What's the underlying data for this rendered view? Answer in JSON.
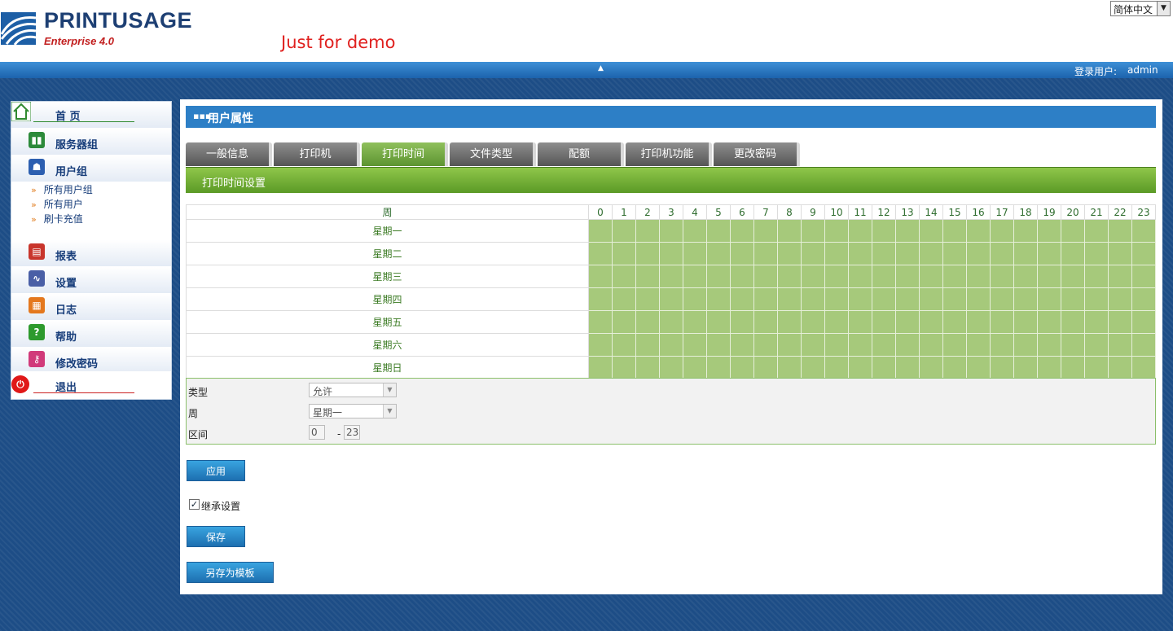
{
  "header": {
    "brand_name": "PRINTUSAGE",
    "brand_edition": "Enterprise 4.0",
    "demo_text": "Just for demo",
    "language": "简体中文"
  },
  "topbar": {
    "login_label": "登录用户:",
    "login_user": "admin"
  },
  "sidebar": {
    "items": [
      {
        "label": "首 页",
        "icon": "home-icon"
      },
      {
        "label": "服务器组",
        "icon": "server-group-icon"
      },
      {
        "label": "用户组",
        "icon": "user-group-icon"
      },
      {
        "label": "报表",
        "icon": "report-icon"
      },
      {
        "label": "设置",
        "icon": "settings-icon"
      },
      {
        "label": "日志",
        "icon": "log-icon"
      },
      {
        "label": "帮助",
        "icon": "help-icon"
      },
      {
        "label": "修改密码",
        "icon": "key-icon"
      },
      {
        "label": "退出",
        "icon": "exit-icon"
      }
    ],
    "sub_items": [
      "所有用户组",
      "所有用户",
      "刷卡充值"
    ]
  },
  "panel": {
    "title": "用户属性",
    "tabs": [
      "一般信息",
      "打印机",
      "打印时间",
      "文件类型",
      "配额",
      "打印机功能",
      "更改密码"
    ],
    "active_tab": "打印时间",
    "section_title": "打印时间设置"
  },
  "grid": {
    "week_header": "周",
    "hours": [
      "0",
      "1",
      "2",
      "3",
      "4",
      "5",
      "6",
      "7",
      "8",
      "9",
      "10",
      "11",
      "12",
      "13",
      "14",
      "15",
      "16",
      "17",
      "18",
      "19",
      "20",
      "21",
      "22",
      "23"
    ],
    "days": [
      "星期一",
      "星期二",
      "星期三",
      "星期四",
      "星期五",
      "星期六",
      "星期日"
    ],
    "slot_color": "#a6c97b"
  },
  "form": {
    "type_label": "类型",
    "type_value": "允许",
    "week_label": "周",
    "week_value": "星期一",
    "range_label": "区间",
    "range_start": "0",
    "range_end": "23",
    "range_separator": "-"
  },
  "buttons": {
    "apply": "应用",
    "inherit_label": "继承设置",
    "save": "保存",
    "save_template": "另存为模板"
  },
  "colors": {
    "topbar": "#1c63ad",
    "section_bar": "#5b9a26",
    "panel_header": "#2d7fc6",
    "demo_text": "#e0211f"
  }
}
